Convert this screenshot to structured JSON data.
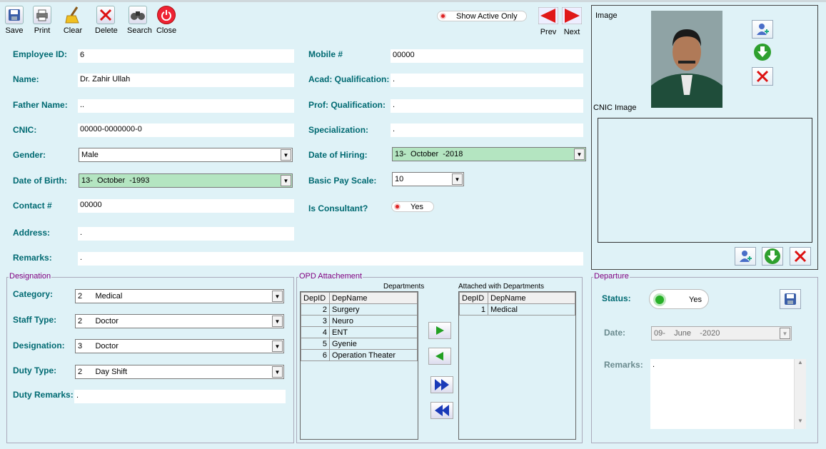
{
  "toolbar": {
    "save": "Save",
    "print": "Print",
    "clear": "Clear",
    "delete": "Delete",
    "search": "Search",
    "close": "Close",
    "show_active_only": "Show Active Only",
    "prev": "Prev",
    "next": "Next"
  },
  "form": {
    "employee_id": {
      "label": "Employee ID:",
      "value": "6"
    },
    "name": {
      "label": "Name:",
      "value": "Dr. Zahir Ullah"
    },
    "father_name": {
      "label": "Father Name:",
      "value": ".."
    },
    "cnic": {
      "label": "CNIC:",
      "value": "00000-0000000-0"
    },
    "gender": {
      "label": "Gender:",
      "value": "Male"
    },
    "dob": {
      "label": "Date of Birth:",
      "value": "13-  October  -1993"
    },
    "contact": {
      "label": "Contact #",
      "value": "00000"
    },
    "address": {
      "label": "Address:",
      "value": "."
    },
    "remarks": {
      "label": "Remarks:",
      "value": "."
    },
    "mobile": {
      "label": "Mobile #",
      "value": "00000"
    },
    "acad_qual": {
      "label": "Acad: Qualification:",
      "value": "."
    },
    "prof_qual": {
      "label": "Prof: Qualification:",
      "value": "."
    },
    "specialization": {
      "label": "Specialization:",
      "value": "."
    },
    "date_of_hiring": {
      "label": "Date of Hiring:",
      "value": "13-  October  -2018"
    },
    "basic_pay_scale": {
      "label": "Basic Pay Scale:",
      "value": "10"
    },
    "is_consultant": {
      "label": "Is Consultant?",
      "value": "Yes"
    }
  },
  "image_panel": {
    "image_label": "Image",
    "cnic_image_label": "CNIC Image"
  },
  "designation": {
    "legend": "Designation",
    "category": {
      "label": "Category:",
      "value": "2      Medical"
    },
    "staff_type": {
      "label": "Staff Type:",
      "value": "2      Doctor"
    },
    "designation": {
      "label": "Designation:",
      "value": "3      Doctor"
    },
    "duty_type": {
      "label": "Duty Type:",
      "value": "2      Day Shift"
    },
    "duty_remarks": {
      "label": "Duty Remarks:",
      "value": "."
    }
  },
  "opd": {
    "legend": "OPD Attachement",
    "departments_title": "Departments",
    "attached_title": "Attached with Departments",
    "columns": [
      "DepID",
      "DepName"
    ],
    "departments": [
      {
        "id": "2",
        "name": "Surgery"
      },
      {
        "id": "3",
        "name": "Neuro"
      },
      {
        "id": "4",
        "name": "ENT"
      },
      {
        "id": "5",
        "name": "Gyenie"
      },
      {
        "id": "6",
        "name": "Operation Theater"
      }
    ],
    "attached": [
      {
        "id": "1",
        "name": "Medical"
      }
    ]
  },
  "departure": {
    "legend": "Departure",
    "status": {
      "label": "Status:",
      "value": "Yes"
    },
    "date": {
      "label": "Date:",
      "value": "09-    June    -2020"
    },
    "remarks": {
      "label": "Remarks:",
      "value": "."
    }
  },
  "colors": {
    "label": "#006a72",
    "legend": "#800080",
    "field_green": "#b4e5c1",
    "background": "#dff2f7"
  }
}
